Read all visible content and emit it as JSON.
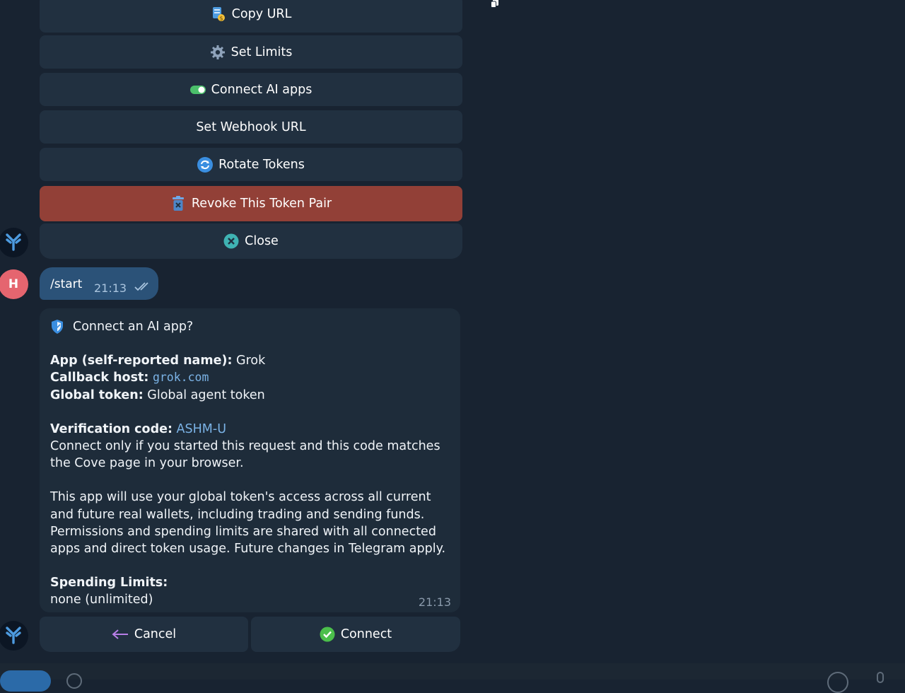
{
  "keyboard": {
    "copy_url": "Copy URL",
    "set_limits": "Set Limits",
    "connect_ai_apps": "Connect AI apps",
    "set_webhook_url": "Set Webhook URL",
    "rotate_tokens": "Rotate Tokens",
    "revoke_pair": "Revoke This Token Pair",
    "close": "Close"
  },
  "user": {
    "avatar_letter": "H"
  },
  "outgoing": {
    "text": "/start",
    "time": "21:13"
  },
  "incoming": {
    "title": "Connect an AI app?",
    "app_label": "App (self-reported name):",
    "app_value": " Grok",
    "callback_label": "Callback host:",
    "callback_value": "grok.com",
    "token_label": "Global token:",
    "token_value": " Global agent token",
    "verification_label": "Verification code:",
    "verification_value": "ASHM-U",
    "verification_note": "Connect only if you started this request and this code matches the Cove page in your browser.",
    "warning": "This app will use your global token's access across all current and future real wallets, including trading and sending funds. Permissions and spending limits are shared with all connected apps and direct token usage. Future changes in Telegram apply.",
    "limits_label": "Spending Limits:",
    "limits_value": "none (unlimited)",
    "time": "21:13"
  },
  "actions": {
    "cancel": "Cancel",
    "connect": "Connect"
  },
  "colors": {
    "background": "#182331",
    "button": "#213040",
    "danger_button": "#924037",
    "outgoing_bubble": "#2b5278",
    "incoming_bubble": "#1e2c3a",
    "link": "#7bb3e6",
    "user_avatar": "#e5656f"
  },
  "icons": [
    "copy-url-icon",
    "gear-icon",
    "toggle-icon",
    "refresh-icon",
    "trash-icon",
    "close-circle-icon",
    "shield-icon",
    "arrow-left-icon",
    "check-circle-icon",
    "bot-logo-icon"
  ]
}
